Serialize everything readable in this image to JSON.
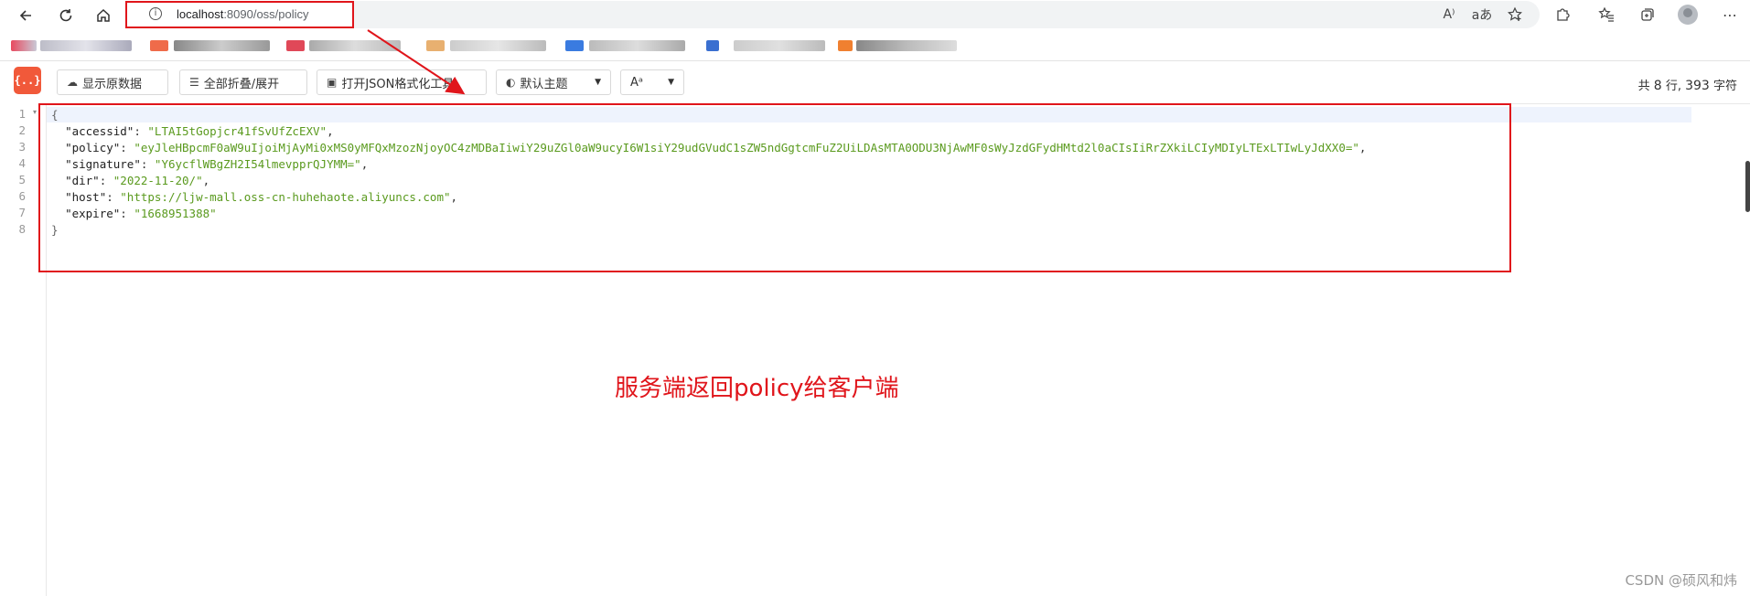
{
  "browser": {
    "url_host": "localhost",
    "url_rest": ":8090/oss/policy",
    "icons": {
      "back": "back-arrow-icon",
      "reload": "reload-icon",
      "home": "home-icon",
      "info": "info-icon",
      "read_aloud": "read-aloud-icon",
      "translate": "translate-icon",
      "favorite_add": "favorite-add-icon",
      "extensions": "extensions-icon",
      "favorites": "favorites-icon",
      "collections": "collections-icon",
      "profile": "profile-avatar",
      "menu": "more-menu-icon"
    },
    "glyphs": {
      "read_aloud": "A⁾",
      "translate": "aあ"
    }
  },
  "toolbar": {
    "logo": "{..}",
    "show_raw": "显示原数据",
    "collapse_expand": "全部折叠/展开",
    "open_formatter": "打开JSON格式化工具",
    "theme": "默认主题",
    "font": "Aᵃ",
    "stats_prefix": "共",
    "line_count": "8",
    "stats_mid": "行,",
    "char_count": "393",
    "stats_suffix": "字符"
  },
  "editor": {
    "line_numbers": [
      "1",
      "2",
      "3",
      "4",
      "5",
      "6",
      "7",
      "8"
    ],
    "lines": [
      {
        "open": "{"
      },
      {
        "key": "\"accessid\"",
        "value": "\"LTAI5tGopjcr41fSvUfZcEXV\"",
        "comma": ","
      },
      {
        "key": "\"policy\"",
        "value": "\"eyJleHBpcmF0aW9uIjoiMjAyMi0xMS0yMFQxMzozNjoyOC4zMDBaIiwiY29uZGl0aW9ucyI6W1siY29udGVudC1sZW5ndGgtcmFuZ2UiLDAsMTA0ODU3NjAwMF0sWyJzdGFydHMtd2l0aCIsIiRrZXkiLCIyMDIyLTExLTIwLyJdXX0=\"",
        "comma": ","
      },
      {
        "key": "\"signature\"",
        "value": "\"Y6ycflWBgZH2I54lmevpprQJYMM=\"",
        "comma": ","
      },
      {
        "key": "\"dir\"",
        "value": "\"2022-11-20/\"",
        "comma": ","
      },
      {
        "key": "\"host\"",
        "value": "\"https://ljw-mall.oss-cn-huhehaote.aliyuncs.com\"",
        "comma": ","
      },
      {
        "key": "\"expire\"",
        "value": "\"1668951388\"",
        "comma": ""
      },
      {
        "close": "}"
      }
    ]
  },
  "annotation": {
    "caption": "服务端返回policy给客户端",
    "color": "#e0151b"
  },
  "watermark": "CSDN @硕风和炜"
}
